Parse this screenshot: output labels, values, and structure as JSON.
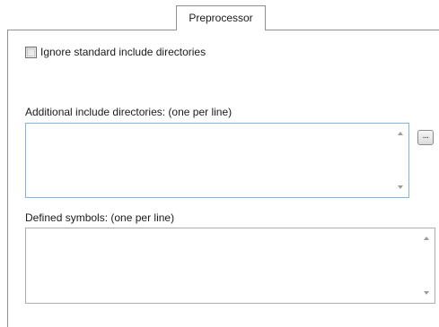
{
  "tabs": [
    {
      "label": "Preprocessor",
      "active": true
    }
  ],
  "ignore_standard": {
    "label": "Ignore standard include directories",
    "checked": false
  },
  "include_dirs": {
    "label": "Additional include directories: (one per line)",
    "value": "",
    "browse_label": "..."
  },
  "defined_symbols": {
    "label": "Defined symbols: (one per line)",
    "value": ""
  },
  "colors": {
    "border": "#8e8f8f",
    "focus_border": "#7eb4ea",
    "input_border": "#abadb3",
    "arrow": "#9a9a9a"
  }
}
